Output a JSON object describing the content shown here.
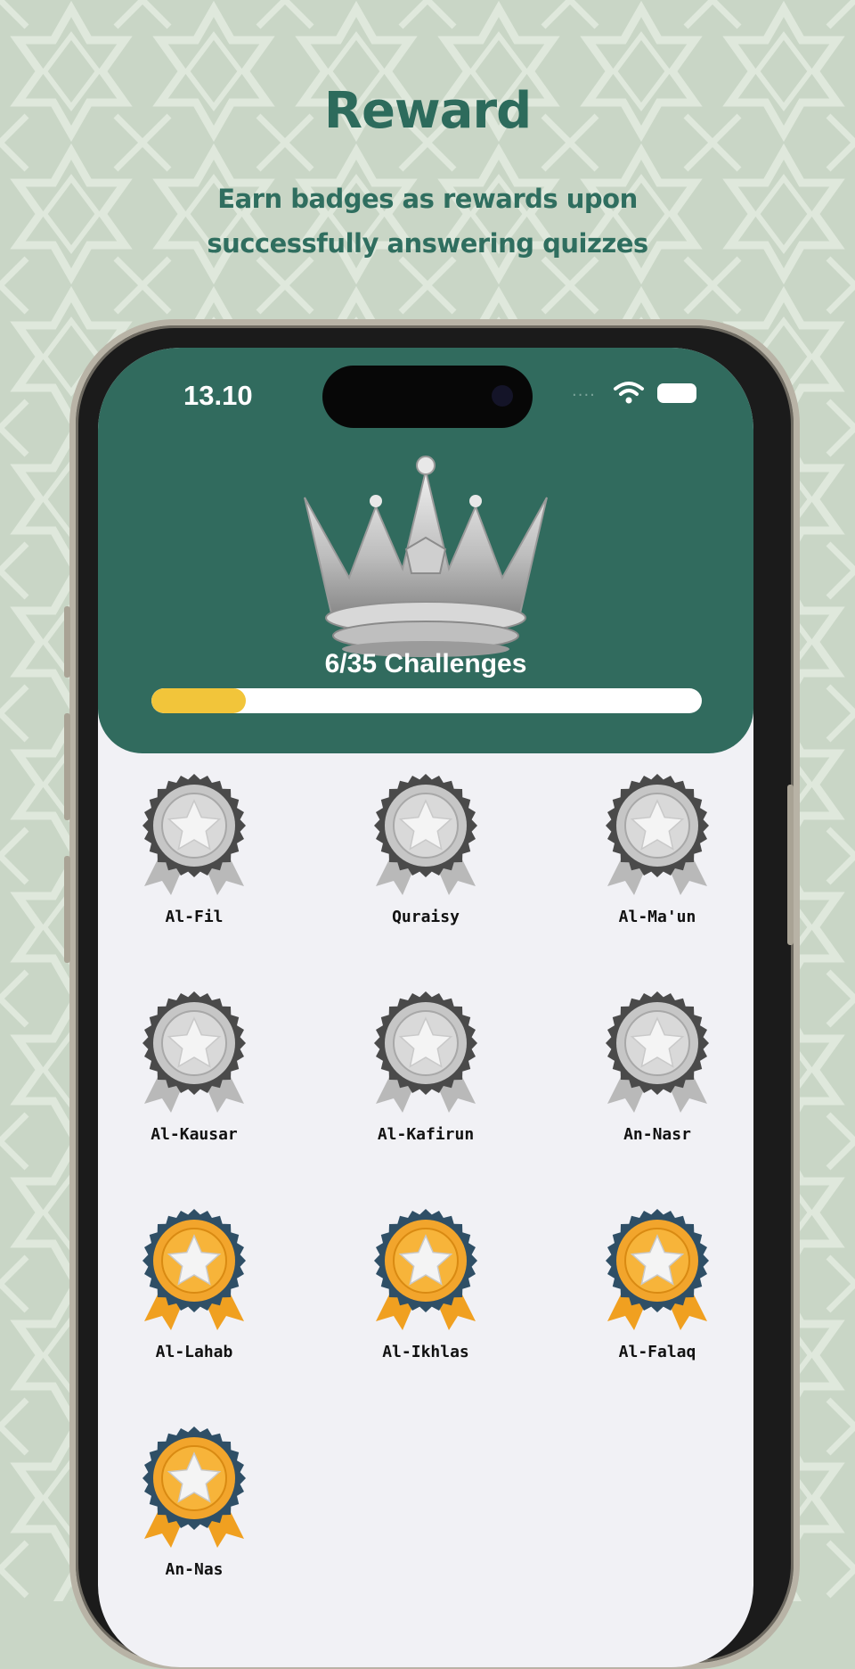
{
  "promo": {
    "title": "Reward",
    "subtitle": "Earn badges as rewards upon successfully answering quizzes"
  },
  "status_bar": {
    "time": "13.10",
    "signal": "....",
    "wifi_icon": "wifi-icon",
    "battery_icon": "battery-icon"
  },
  "progress": {
    "label": "6/35 Challenges",
    "completed": 6,
    "total": 35
  },
  "colors": {
    "background": "#c9d6c6",
    "accent_green": "#316b5e",
    "title_green": "#2d6b5c",
    "progress_fill": "#f2c53a",
    "silver": "#c8c8c8",
    "gold": "#f2a52c",
    "gold_ring": "#2f4f66"
  },
  "badges": [
    {
      "label": "Al-Fil",
      "tier": "silver"
    },
    {
      "label": "Quraisy",
      "tier": "silver"
    },
    {
      "label": "Al-Ma'un",
      "tier": "silver"
    },
    {
      "label": "Al-Kausar",
      "tier": "silver"
    },
    {
      "label": "Al-Kafirun",
      "tier": "silver"
    },
    {
      "label": "An-Nasr",
      "tier": "silver"
    },
    {
      "label": "Al-Lahab",
      "tier": "gold"
    },
    {
      "label": "Al-Ikhlas",
      "tier": "gold"
    },
    {
      "label": "Al-Falaq",
      "tier": "gold"
    },
    {
      "label": "An-Nas",
      "tier": "gold"
    }
  ]
}
